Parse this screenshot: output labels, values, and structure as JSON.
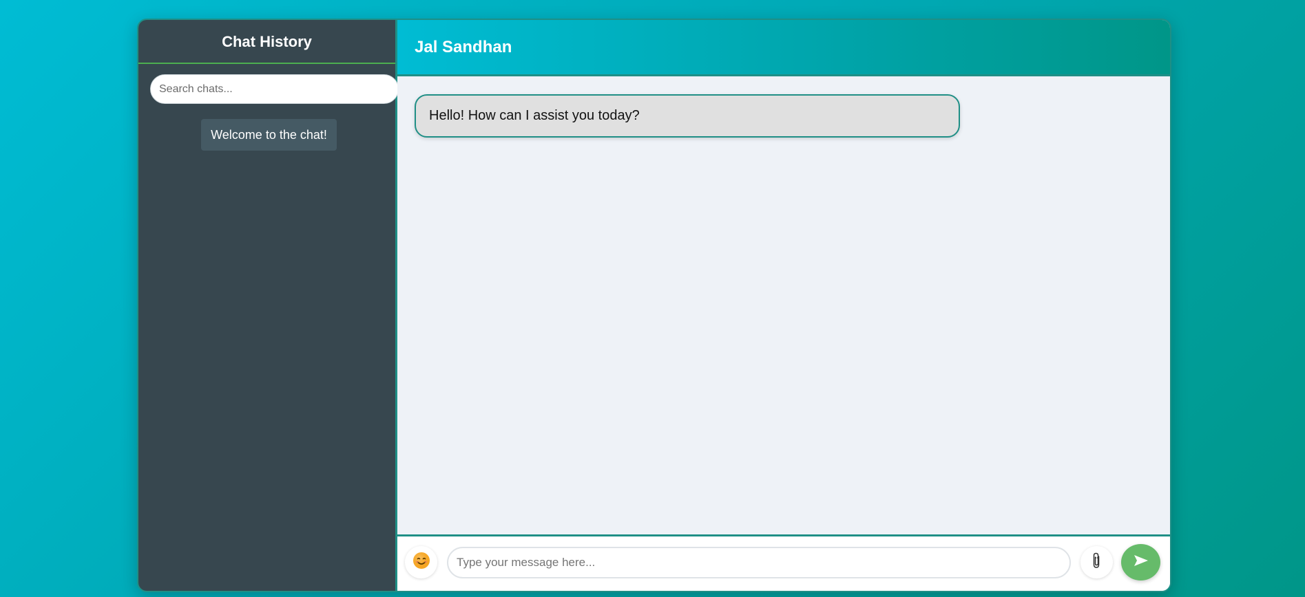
{
  "sidebar": {
    "title": "Chat History",
    "search": {
      "placeholder": "Search chats...",
      "value": ""
    },
    "items": [
      {
        "label": "Welcome to the chat!"
      }
    ]
  },
  "chat": {
    "title": "Jal Sandhan",
    "messages": [
      {
        "sender": "bot",
        "text": "Hello! How can I assist you today?"
      }
    ]
  },
  "composer": {
    "placeholder": "Type your message here...",
    "value": "",
    "emoji_icon": "smiley-face-icon",
    "attach_icon": "paperclip-icon",
    "send_icon": "send-arrow-icon"
  },
  "colors": {
    "background_start": "#00bcd4",
    "background_end": "#009688",
    "sidebar_bg": "#37474f",
    "sidebar_item_bg": "#455a64",
    "accent_border": "#1f8f86",
    "divider_green": "#4caf50",
    "send_button": "#66bb6a",
    "message_bubble": "#e0e0e0"
  }
}
